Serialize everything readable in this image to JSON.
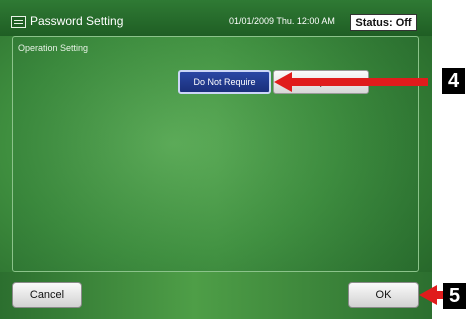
{
  "titlebar": {
    "title": "Password Setting",
    "datetime": "01/01/2009 Thu. 12:00 AM",
    "status": "Status: Off",
    "icon": "menu-icon"
  },
  "main": {
    "section_label": "Operation Setting",
    "options": [
      {
        "label": "Do Not Require",
        "selected": true
      },
      {
        "label": "Require",
        "selected": false
      }
    ]
  },
  "footer": {
    "cancel_label": "Cancel",
    "ok_label": "OK"
  },
  "callouts": [
    {
      "number": "4",
      "target": "Do Not Require"
    },
    {
      "number": "5",
      "target": "OK"
    }
  ],
  "colors": {
    "screen_green": "#3f8f3f",
    "selected_blue": "#1f3b8f",
    "callout_red": "#e01c1c",
    "callout_black": "#000000"
  }
}
